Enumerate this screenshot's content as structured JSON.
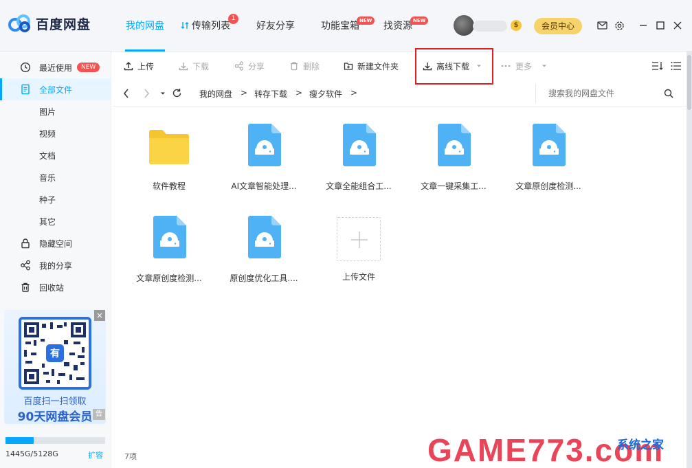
{
  "app": {
    "logo_text": "百度网盘"
  },
  "nav": {
    "items": [
      {
        "label": "我的网盘",
        "active": true
      },
      {
        "label": "传输列表",
        "badge": "1"
      },
      {
        "label": "好友分享"
      },
      {
        "label": "功能宝箱",
        "badge": "NEW"
      },
      {
        "label": "找资源",
        "badge": "NEW"
      }
    ]
  },
  "user": {
    "coin_icon": "$",
    "vip_label": "会员中心"
  },
  "sidebar": {
    "items": [
      {
        "label": "最近使用",
        "icon": "clock-icon",
        "badge": "NEW"
      },
      {
        "label": "全部文件",
        "icon": "document-icon",
        "active": true
      },
      {
        "label": "图片"
      },
      {
        "label": "视频"
      },
      {
        "label": "文档"
      },
      {
        "label": "音乐"
      },
      {
        "label": "种子"
      },
      {
        "label": "其它"
      },
      {
        "label": "隐藏空间",
        "icon": "lock-icon"
      },
      {
        "label": "我的分享",
        "icon": "share-icon"
      },
      {
        "label": "回收站",
        "icon": "trash-icon"
      }
    ],
    "promo": {
      "line1": "百度扫一扫领取",
      "line2": "90天网盘会员",
      "close": "×",
      "ad": "告"
    },
    "storage": {
      "used_text": "1445G/5128G",
      "used_fraction": 0.282,
      "expand_label": "扩容"
    }
  },
  "toolbar": {
    "upload": "上传",
    "download": "下载",
    "share": "分享",
    "delete": "删除",
    "new_folder": "新建文件夹",
    "offline_download": "离线下载",
    "more": "更多"
  },
  "path": {
    "crumbs": [
      "我的网盘",
      "转存下载",
      "瘦夕软件"
    ],
    "separator": ">",
    "search_placeholder": "搜索我的网盘文件"
  },
  "files": [
    {
      "name": "软件教程",
      "type": "folder"
    },
    {
      "name": "AI文章智能处理...",
      "type": "disc"
    },
    {
      "name": "文章全能组合工...",
      "type": "disc"
    },
    {
      "name": "文章一键采集工...",
      "type": "disc"
    },
    {
      "name": "文章原创度检测...",
      "type": "disc"
    },
    {
      "name": "文章原创度检测...",
      "type": "disc"
    },
    {
      "name": "原创度优化工具....",
      "type": "disc"
    },
    {
      "name": "上传文件",
      "type": "upload"
    }
  ],
  "status": {
    "count_text": "7项"
  },
  "watermark": {
    "text": "GAME773",
    "suffix": ".com",
    "site_text": "系统之家"
  },
  "colors": {
    "accent": "#06a7ff",
    "badge": "#f25454",
    "vip": "#f7d36b",
    "highlight": "#e02020"
  }
}
